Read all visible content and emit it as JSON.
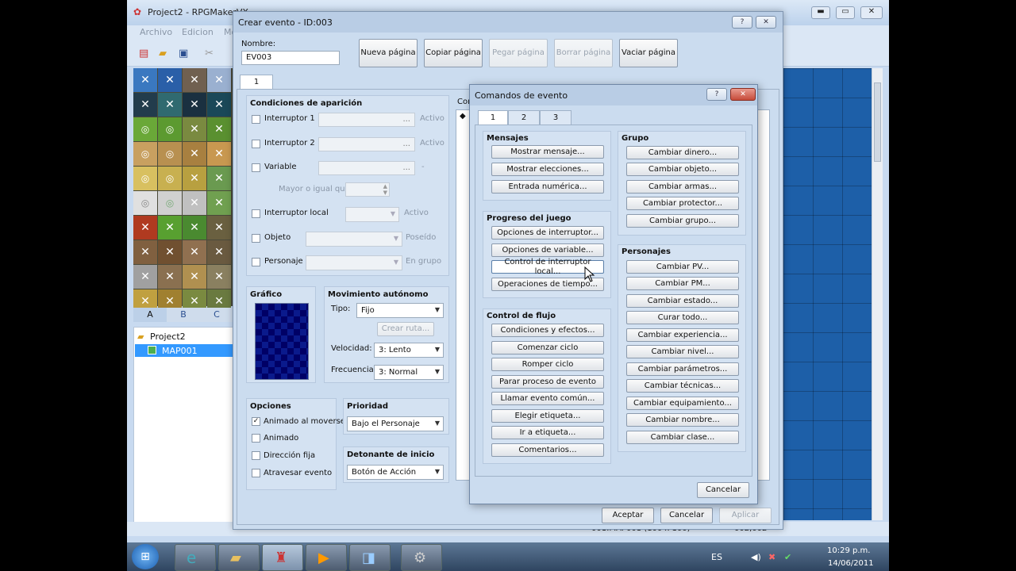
{
  "main_window": {
    "title": "Project2 - RPGMakerVX",
    "menus": [
      "Archivo",
      "Edicion",
      "Mo"
    ]
  },
  "tile_tabs": [
    "A",
    "B",
    "C"
  ],
  "map_tree": {
    "project": "Project2",
    "map": "MAP001"
  },
  "status": {
    "map_info": "001:MAP001 (100 x 100)",
    "coords": "002,002"
  },
  "event_window": {
    "title": "Crear evento - ID:003",
    "name_label": "Nombre:",
    "name_value": "EV003",
    "page_buttons": [
      {
        "label": "Nueva página",
        "enabled": true
      },
      {
        "label": "Copiar página",
        "enabled": true
      },
      {
        "label": "Pegar página",
        "enabled": false
      },
      {
        "label": "Borrar página",
        "enabled": false
      },
      {
        "label": "Vaciar página",
        "enabled": true
      }
    ],
    "page_tab": "1",
    "conditions": {
      "header": "Condiciones de aparición",
      "switch1": "Interruptor 1",
      "switch1_state": "Activo",
      "switch2": "Interruptor 2",
      "switch2_state": "Activo",
      "variable": "Variable",
      "variable_note": "Mayor o igual que",
      "local_switch": "Interruptor local",
      "local_state": "Activo",
      "item": "Objeto",
      "item_state": "Poseído",
      "actor": "Personaje",
      "actor_state": "En grupo",
      "dots": "...",
      "dash": "-"
    },
    "graphic": {
      "header": "Gráfico"
    },
    "movement": {
      "header": "Movimiento autónomo",
      "type_label": "Tipo:",
      "type_value": "Fijo",
      "route_button": "Crear ruta...",
      "speed_label": "Velocidad:",
      "speed_value": "3: Lento",
      "freq_label": "Frecuencia:",
      "freq_value": "3: Normal"
    },
    "options": {
      "header": "Opciones",
      "items": [
        {
          "label": "Animado al moverse",
          "checked": true
        },
        {
          "label": "Animado",
          "checked": false
        },
        {
          "label": "Dirección fija",
          "checked": false
        },
        {
          "label": "Atravesar evento",
          "checked": false
        }
      ]
    },
    "priority": {
      "header": "Prioridad",
      "value": "Bajo el Personaje"
    },
    "trigger": {
      "header": "Detonante de inicio",
      "value": "Botón de Acción"
    },
    "contents_header": "Con",
    "buttons": {
      "ok": "Aceptar",
      "cancel": "Cancelar",
      "apply": "Aplicar"
    }
  },
  "commands_window": {
    "title": "Comandos de evento",
    "tabs": [
      "1",
      "2",
      "3"
    ],
    "groups": {
      "messages": {
        "header": "Mensajes",
        "items": [
          "Mostrar mensaje...",
          "Mostrar elecciones...",
          "Entrada numérica..."
        ]
      },
      "progress": {
        "header": "Progreso del juego",
        "items": [
          "Opciones de interruptor...",
          "Opciones de variable...",
          "Control de interruptor local...",
          "Operaciones de tiempo..."
        ]
      },
      "flow": {
        "header": "Control de flujo",
        "items": [
          "Condiciones y efectos...",
          "Comenzar ciclo",
          "Romper ciclo",
          "Parar proceso de evento",
          "Llamar evento común...",
          "Elegir etiqueta...",
          "Ir a etiqueta...",
          "Comentarios..."
        ]
      },
      "party": {
        "header": "Grupo",
        "items": [
          "Cambiar dinero...",
          "Cambiar objeto...",
          "Cambiar armas...",
          "Cambiar protector...",
          "Cambiar grupo..."
        ]
      },
      "actors": {
        "header": "Personajes",
        "items": [
          "Cambiar PV...",
          "Cambiar PM...",
          "Cambiar estado...",
          "Curar todo...",
          "Cambiar experiencia...",
          "Cambiar nivel...",
          "Cambiar parámetros...",
          "Cambiar técnicas...",
          "Cambiar equipamiento...",
          "Cambiar nombre...",
          "Cambiar clase..."
        ]
      }
    },
    "cancel": "Cancelar"
  },
  "taskbar": {
    "lang": "ES",
    "time": "10:29 p.m.",
    "date": "14/06/2011"
  },
  "colors": {
    "desktop": "#c8daf0",
    "panel": "#d4e2f2",
    "water": "#1d5fa8",
    "checker_a": "#0a1a8c",
    "checker_b": "#000066"
  }
}
